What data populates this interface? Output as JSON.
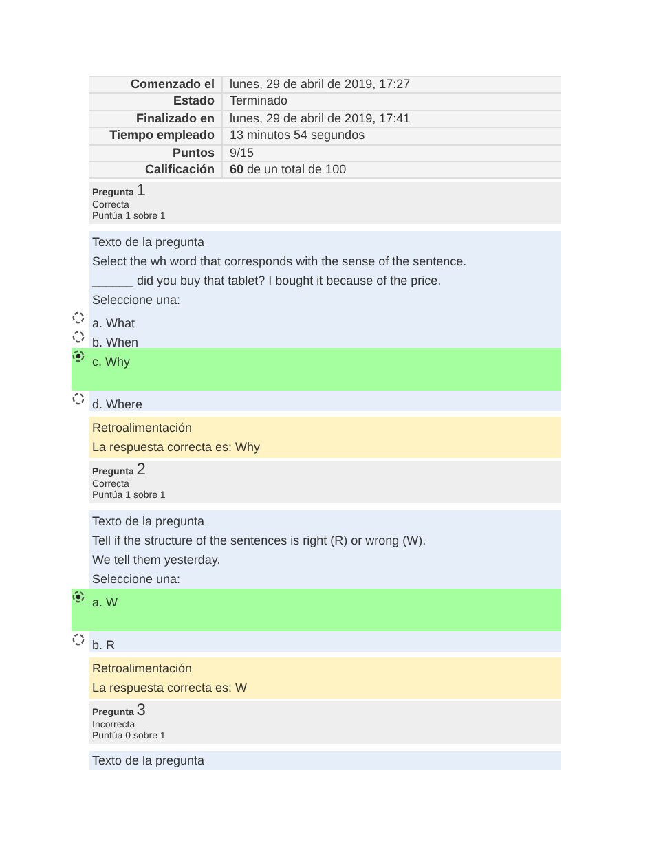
{
  "summary": [
    {
      "label": "Comenzado el",
      "value": "lunes, 29 de abril de 2019, 17:27"
    },
    {
      "label": "Estado",
      "value": "Terminado"
    },
    {
      "label": "Finalizado en",
      "value": "lunes, 29 de abril de 2019, 17:41"
    },
    {
      "label": "Tiempo empleado",
      "value": "13 minutos 54 segundos"
    },
    {
      "label": "Puntos",
      "value": "9/15"
    },
    {
      "label": "Calificación",
      "value": "**60** de un total de 100"
    }
  ],
  "questions": [
    {
      "label": "Pregunta",
      "number": "1",
      "status": "Correcta",
      "score": "Puntúa 1 sobre 1",
      "text_heading": "Texto de la pregunta",
      "lines": [
        "Select the wh word that corresponds with the sense of the sentence.",
        "______ did you buy that tablet? I bought it because of the price."
      ],
      "prompt": "Seleccione una:",
      "options": [
        {
          "text": "a. What",
          "selected": false,
          "correct": false
        },
        {
          "text": "b. When",
          "selected": false,
          "correct": false
        },
        {
          "text": "c. Why",
          "selected": true,
          "correct": true
        },
        {
          "text": "d. Where",
          "selected": false,
          "correct": false
        }
      ],
      "feedback_heading": "Retroalimentación",
      "feedback": "La respuesta correcta es: Why"
    },
    {
      "label": "Pregunta",
      "number": "2",
      "status": "Correcta",
      "score": "Puntúa 1 sobre 1",
      "text_heading": "Texto de la pregunta",
      "lines": [
        "Tell if the structure of the sentences is right (R) or wrong (W).",
        "We tell them yesterday."
      ],
      "prompt": "Seleccione una:",
      "options": [
        {
          "text": "a. W",
          "selected": true,
          "correct": true
        },
        {
          "text": "b. R",
          "selected": false,
          "correct": false
        }
      ],
      "feedback_heading": "Retroalimentación",
      "feedback": "La respuesta correcta es: W"
    },
    {
      "label": "Pregunta",
      "number": "3",
      "status": "Incorrecta",
      "score": "Puntúa 0 sobre 1",
      "text_heading": "Texto de la pregunta"
    }
  ]
}
